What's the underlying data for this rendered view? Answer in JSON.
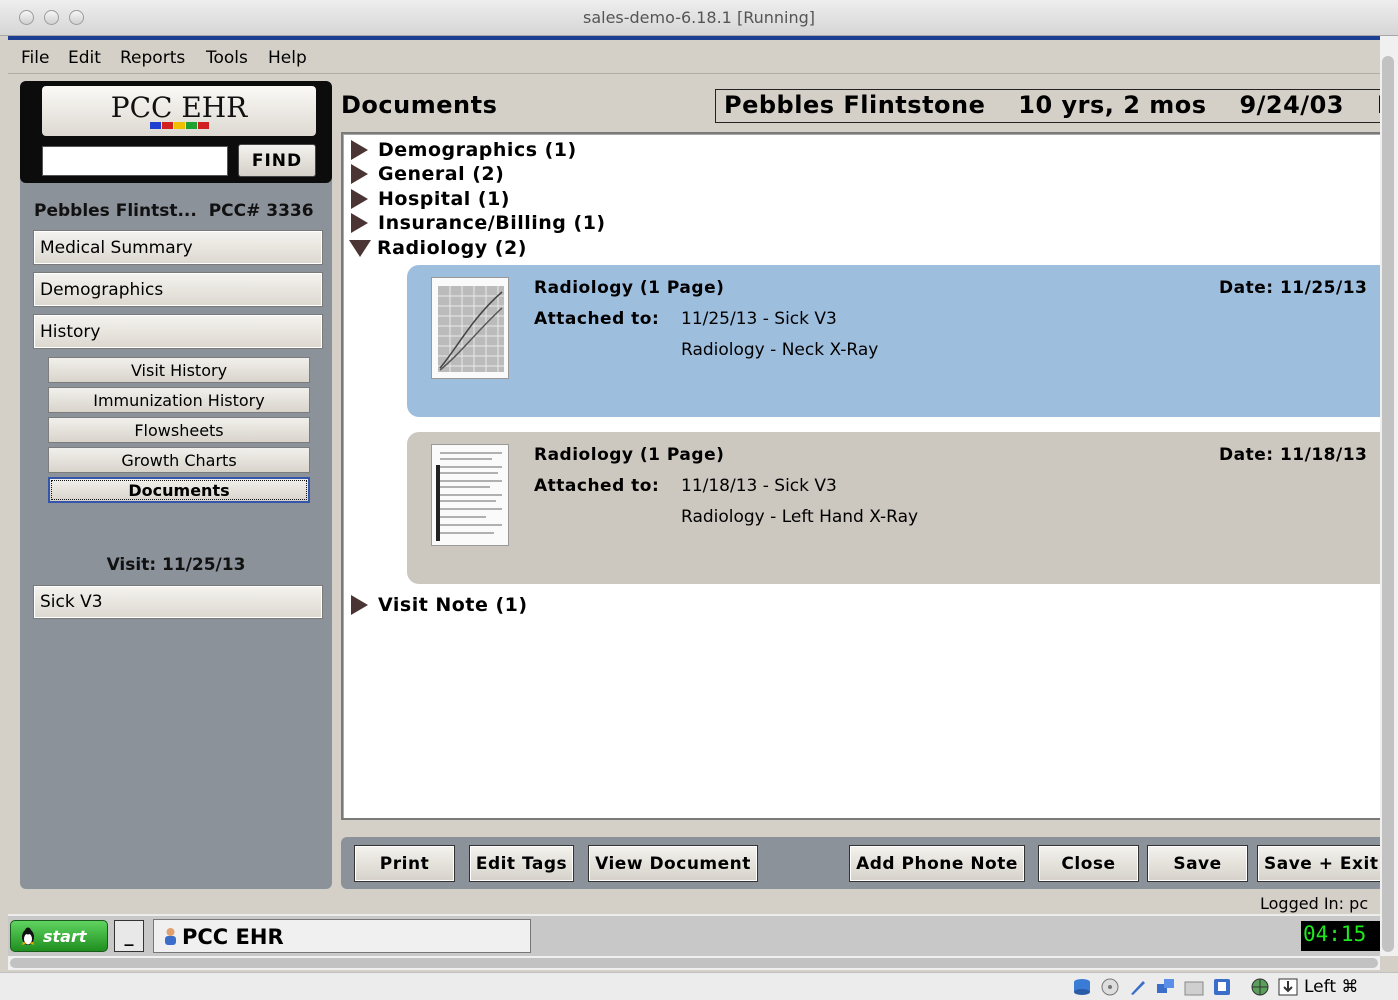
{
  "window": {
    "title": "sales-demo-6.18.1 [Running]"
  },
  "menu": [
    "File",
    "Edit",
    "Reports",
    "Tools",
    "Help"
  ],
  "logo": {
    "text": "PCC EHR"
  },
  "find": {
    "value": "",
    "button": "FIND"
  },
  "patient": {
    "short_name": "Pebbles Flintst...",
    "pcc_label": "PCC# 3336"
  },
  "nav": {
    "medical_summary": "Medical Summary",
    "demographics": "Demographics",
    "history": "History",
    "sub": [
      "Visit History",
      "Immunization History",
      "Flowsheets",
      "Growth Charts",
      "Documents"
    ],
    "visit_label": "Visit: 11/25/13",
    "visit_button": "Sick V3"
  },
  "main": {
    "title": "Documents",
    "banner": {
      "name": "Pebbles Flintstone",
      "age": "10 yrs, 2 mos",
      "dob": "9/24/03",
      "extra": "F"
    }
  },
  "categories": [
    {
      "label": "Demographics (1)",
      "expanded": false
    },
    {
      "label": "General (2)",
      "expanded": false
    },
    {
      "label": "Hospital (1)",
      "expanded": false
    },
    {
      "label": "Insurance/Billing (1)",
      "expanded": false
    },
    {
      "label": "Radiology (2)",
      "expanded": true
    },
    {
      "label": "Visit Note (1)",
      "expanded": false
    }
  ],
  "documents": [
    {
      "title": "Radiology (1 Page)",
      "date_label": "Date: 11/25/13",
      "attached_label": "Attached to:",
      "visit": "11/25/13 - Sick V3",
      "description": "Radiology - Neck X-Ray",
      "selected": true
    },
    {
      "title": "Radiology (1 Page)",
      "date_label": "Date: 11/18/13",
      "attached_label": "Attached to:",
      "visit": "11/18/13 - Sick V3",
      "description": "Radiology - Left Hand X-Ray",
      "selected": false
    }
  ],
  "buttons": {
    "print": "Print",
    "edit_tags": "Edit Tags",
    "view_document": "View Document",
    "add_phone_note": "Add Phone Note",
    "close": "Close",
    "save": "Save",
    "save_exit": "Save + Exit"
  },
  "logged_in": "Logged In: pc",
  "taskbar": {
    "start": "start",
    "minimize": "_",
    "task": "PCC EHR",
    "clock": "04:15"
  },
  "host_status": {
    "key": "Left ⌘"
  },
  "colors": {
    "selected_card": "#9ebede",
    "card": "#ccc7bf",
    "panel": "#8c929a",
    "triangle": "#4a3434",
    "clock_text": "#1ee81e"
  }
}
